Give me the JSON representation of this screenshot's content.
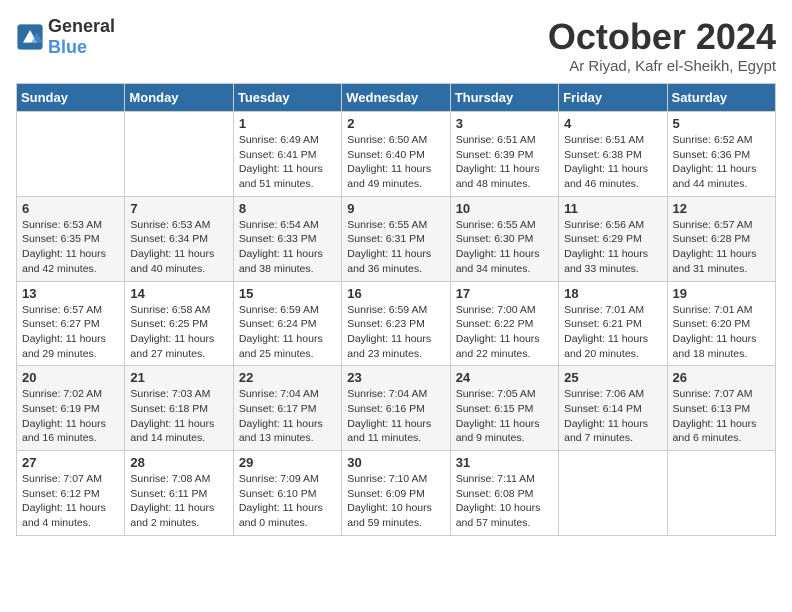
{
  "header": {
    "logo_general": "General",
    "logo_blue": "Blue",
    "month": "October 2024",
    "location": "Ar Riyad, Kafr el-Sheikh, Egypt"
  },
  "days_of_week": [
    "Sunday",
    "Monday",
    "Tuesday",
    "Wednesday",
    "Thursday",
    "Friday",
    "Saturday"
  ],
  "weeks": [
    [
      {
        "day": "",
        "content": ""
      },
      {
        "day": "",
        "content": ""
      },
      {
        "day": "1",
        "content": "Sunrise: 6:49 AM\nSunset: 6:41 PM\nDaylight: 11 hours and 51 minutes."
      },
      {
        "day": "2",
        "content": "Sunrise: 6:50 AM\nSunset: 6:40 PM\nDaylight: 11 hours and 49 minutes."
      },
      {
        "day": "3",
        "content": "Sunrise: 6:51 AM\nSunset: 6:39 PM\nDaylight: 11 hours and 48 minutes."
      },
      {
        "day": "4",
        "content": "Sunrise: 6:51 AM\nSunset: 6:38 PM\nDaylight: 11 hours and 46 minutes."
      },
      {
        "day": "5",
        "content": "Sunrise: 6:52 AM\nSunset: 6:36 PM\nDaylight: 11 hours and 44 minutes."
      }
    ],
    [
      {
        "day": "6",
        "content": "Sunrise: 6:53 AM\nSunset: 6:35 PM\nDaylight: 11 hours and 42 minutes."
      },
      {
        "day": "7",
        "content": "Sunrise: 6:53 AM\nSunset: 6:34 PM\nDaylight: 11 hours and 40 minutes."
      },
      {
        "day": "8",
        "content": "Sunrise: 6:54 AM\nSunset: 6:33 PM\nDaylight: 11 hours and 38 minutes."
      },
      {
        "day": "9",
        "content": "Sunrise: 6:55 AM\nSunset: 6:31 PM\nDaylight: 11 hours and 36 minutes."
      },
      {
        "day": "10",
        "content": "Sunrise: 6:55 AM\nSunset: 6:30 PM\nDaylight: 11 hours and 34 minutes."
      },
      {
        "day": "11",
        "content": "Sunrise: 6:56 AM\nSunset: 6:29 PM\nDaylight: 11 hours and 33 minutes."
      },
      {
        "day": "12",
        "content": "Sunrise: 6:57 AM\nSunset: 6:28 PM\nDaylight: 11 hours and 31 minutes."
      }
    ],
    [
      {
        "day": "13",
        "content": "Sunrise: 6:57 AM\nSunset: 6:27 PM\nDaylight: 11 hours and 29 minutes."
      },
      {
        "day": "14",
        "content": "Sunrise: 6:58 AM\nSunset: 6:25 PM\nDaylight: 11 hours and 27 minutes."
      },
      {
        "day": "15",
        "content": "Sunrise: 6:59 AM\nSunset: 6:24 PM\nDaylight: 11 hours and 25 minutes."
      },
      {
        "day": "16",
        "content": "Sunrise: 6:59 AM\nSunset: 6:23 PM\nDaylight: 11 hours and 23 minutes."
      },
      {
        "day": "17",
        "content": "Sunrise: 7:00 AM\nSunset: 6:22 PM\nDaylight: 11 hours and 22 minutes."
      },
      {
        "day": "18",
        "content": "Sunrise: 7:01 AM\nSunset: 6:21 PM\nDaylight: 11 hours and 20 minutes."
      },
      {
        "day": "19",
        "content": "Sunrise: 7:01 AM\nSunset: 6:20 PM\nDaylight: 11 hours and 18 minutes."
      }
    ],
    [
      {
        "day": "20",
        "content": "Sunrise: 7:02 AM\nSunset: 6:19 PM\nDaylight: 11 hours and 16 minutes."
      },
      {
        "day": "21",
        "content": "Sunrise: 7:03 AM\nSunset: 6:18 PM\nDaylight: 11 hours and 14 minutes."
      },
      {
        "day": "22",
        "content": "Sunrise: 7:04 AM\nSunset: 6:17 PM\nDaylight: 11 hours and 13 minutes."
      },
      {
        "day": "23",
        "content": "Sunrise: 7:04 AM\nSunset: 6:16 PM\nDaylight: 11 hours and 11 minutes."
      },
      {
        "day": "24",
        "content": "Sunrise: 7:05 AM\nSunset: 6:15 PM\nDaylight: 11 hours and 9 minutes."
      },
      {
        "day": "25",
        "content": "Sunrise: 7:06 AM\nSunset: 6:14 PM\nDaylight: 11 hours and 7 minutes."
      },
      {
        "day": "26",
        "content": "Sunrise: 7:07 AM\nSunset: 6:13 PM\nDaylight: 11 hours and 6 minutes."
      }
    ],
    [
      {
        "day": "27",
        "content": "Sunrise: 7:07 AM\nSunset: 6:12 PM\nDaylight: 11 hours and 4 minutes."
      },
      {
        "day": "28",
        "content": "Sunrise: 7:08 AM\nSunset: 6:11 PM\nDaylight: 11 hours and 2 minutes."
      },
      {
        "day": "29",
        "content": "Sunrise: 7:09 AM\nSunset: 6:10 PM\nDaylight: 11 hours and 0 minutes."
      },
      {
        "day": "30",
        "content": "Sunrise: 7:10 AM\nSunset: 6:09 PM\nDaylight: 10 hours and 59 minutes."
      },
      {
        "day": "31",
        "content": "Sunrise: 7:11 AM\nSunset: 6:08 PM\nDaylight: 10 hours and 57 minutes."
      },
      {
        "day": "",
        "content": ""
      },
      {
        "day": "",
        "content": ""
      }
    ]
  ]
}
